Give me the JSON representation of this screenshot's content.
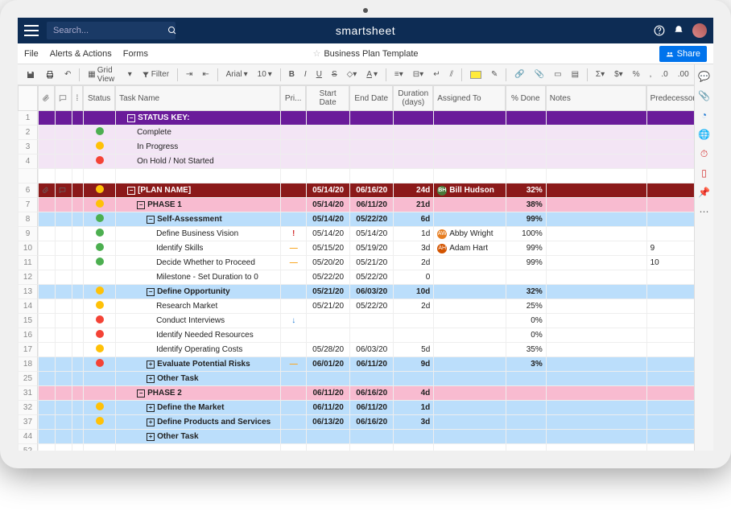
{
  "header": {
    "logo": "smartsheet",
    "search_placeholder": "Search..."
  },
  "menubar": {
    "file": "File",
    "alerts": "Alerts & Actions",
    "forms": "Forms",
    "title": "Business Plan Template",
    "share": "Share"
  },
  "toolbar": {
    "gridview": "Grid View",
    "filter": "Filter",
    "font": "Arial",
    "size": "10"
  },
  "columns": {
    "status": "Status",
    "task": "Task Name",
    "pri": "Pri...",
    "start": "Start Date",
    "end": "End Date",
    "dur": "Duration (days)",
    "assign": "Assigned To",
    "done": "% Done",
    "notes": "Notes",
    "pred": "Predecessors"
  },
  "rows": [
    {
      "n": "1",
      "type": "purplehdr",
      "task": "STATUS KEY:",
      "indent": 1,
      "exp": "-"
    },
    {
      "n": "2",
      "type": "lavender",
      "status": "green",
      "task": "Complete",
      "indent": 2
    },
    {
      "n": "3",
      "type": "lavender",
      "status": "yellowd",
      "task": "In Progress",
      "indent": 2
    },
    {
      "n": "4",
      "type": "lavender",
      "status": "red",
      "task": "On Hold / Not Started",
      "indent": 2
    },
    {
      "n": "",
      "type": "blank"
    },
    {
      "n": "6",
      "type": "darkred",
      "status": "yellowd",
      "task": "[PLAN NAME]",
      "indent": 1,
      "exp": "-",
      "start": "05/14/20",
      "end": "06/16/20",
      "dur": "24d",
      "assign": "Bill Hudson",
      "av": "bh",
      "done": "32%",
      "attach": true,
      "comment": true
    },
    {
      "n": "7",
      "type": "pink",
      "status": "yellowd",
      "task": "PHASE 1",
      "indent": 2,
      "exp": "-",
      "start": "05/14/20",
      "end": "06/11/20",
      "dur": "21d",
      "done": "38%"
    },
    {
      "n": "8",
      "type": "blue",
      "status": "green",
      "task": "Self-Assessment",
      "indent": 3,
      "exp": "-",
      "start": "05/14/20",
      "end": "05/22/20",
      "dur": "6d",
      "done": "99%"
    },
    {
      "n": "9",
      "type": "white",
      "status": "green",
      "task": "Define Business Vision",
      "indent": 4,
      "pri": "!",
      "start": "05/14/20",
      "end": "05/14/20",
      "dur": "1d",
      "assign": "Abby Wright",
      "av": "aw",
      "done": "100%"
    },
    {
      "n": "10",
      "type": "white",
      "status": "green",
      "task": "Identify Skills",
      "indent": 4,
      "pri": "—",
      "start": "05/15/20",
      "end": "05/19/20",
      "dur": "3d",
      "assign": "Adam Hart",
      "av": "ah",
      "done": "99%",
      "pred": "9"
    },
    {
      "n": "11",
      "type": "white",
      "status": "green",
      "task": "Decide Whether to Proceed",
      "indent": 4,
      "pri": "—",
      "start": "05/20/20",
      "end": "05/21/20",
      "dur": "2d",
      "done": "99%",
      "pred": "10"
    },
    {
      "n": "12",
      "type": "white",
      "task": "Milestone - Set Duration to 0",
      "indent": 4,
      "start": "05/22/20",
      "end": "05/22/20",
      "dur": "0"
    },
    {
      "n": "13",
      "type": "blue",
      "status": "yellowd",
      "task": "Define Opportunity",
      "indent": 3,
      "exp": "-",
      "start": "05/21/20",
      "end": "06/03/20",
      "dur": "10d",
      "done": "32%"
    },
    {
      "n": "14",
      "type": "white",
      "status": "yellowd",
      "task": "Research Market",
      "indent": 4,
      "start": "05/21/20",
      "end": "05/22/20",
      "dur": "2d",
      "done": "25%"
    },
    {
      "n": "15",
      "type": "white",
      "status": "red",
      "task": "Conduct Interviews",
      "indent": 4,
      "pri": "↓",
      "done": "0%"
    },
    {
      "n": "16",
      "type": "white",
      "status": "red",
      "task": "Identify Needed Resources",
      "indent": 4,
      "done": "0%"
    },
    {
      "n": "17",
      "type": "white",
      "status": "yellowd",
      "task": "Identify Operating Costs",
      "indent": 4,
      "start": "05/28/20",
      "end": "06/03/20",
      "dur": "5d",
      "done": "35%"
    },
    {
      "n": "18",
      "type": "blue",
      "status": "red",
      "task": "Evaluate Potential Risks",
      "indent": 3,
      "exp": "+",
      "pri": "—",
      "start": "06/01/20",
      "end": "06/11/20",
      "dur": "9d",
      "done": "3%"
    },
    {
      "n": "25",
      "type": "blue",
      "task": "Other Task",
      "indent": 3,
      "exp": "+"
    },
    {
      "n": "31",
      "type": "pink",
      "task": "PHASE 2",
      "indent": 2,
      "exp": "-",
      "start": "06/11/20",
      "end": "06/16/20",
      "dur": "4d"
    },
    {
      "n": "32",
      "type": "blue",
      "status": "yellowd",
      "task": "Define the Market",
      "indent": 3,
      "exp": "+",
      "start": "06/11/20",
      "end": "06/11/20",
      "dur": "1d"
    },
    {
      "n": "37",
      "type": "blue",
      "status": "yellowd",
      "task": "Define Products and Services",
      "indent": 3,
      "exp": "+",
      "start": "06/13/20",
      "end": "06/16/20",
      "dur": "3d"
    },
    {
      "n": "44",
      "type": "blue",
      "task": "Other Task",
      "indent": 3,
      "exp": "+"
    },
    {
      "n": "52",
      "type": "blank"
    }
  ]
}
